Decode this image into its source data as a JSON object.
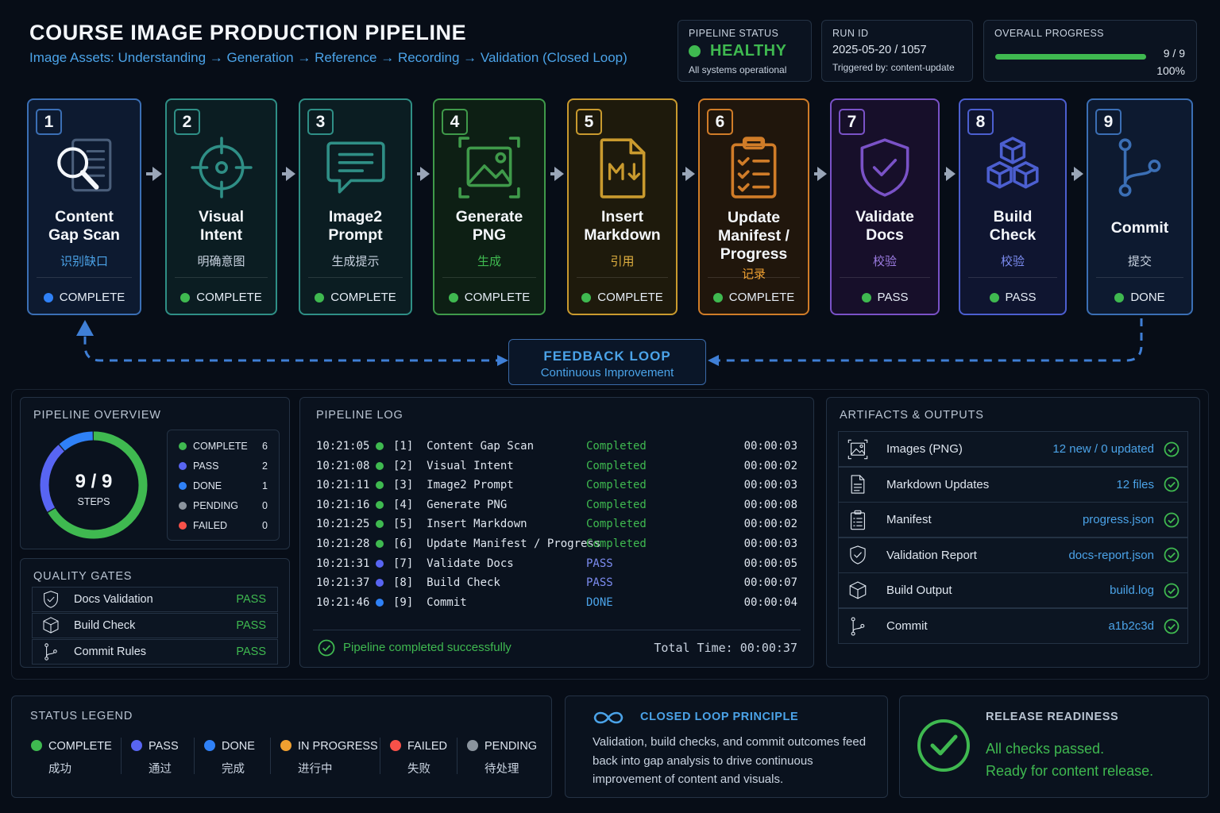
{
  "header": {
    "title": "COURSE IMAGE PRODUCTION PIPELINE",
    "subtitle": "Image Assets: Understanding → Generation → Reference → Recording → Validation (Closed Loop)"
  },
  "pipeline_status": {
    "label": "PIPELINE STATUS",
    "value": "HEALTHY",
    "sub": "All systems operational",
    "color": "#3fb950"
  },
  "run": {
    "label": "RUN ID",
    "value": "2025-05-20 / 1057",
    "sub": "Triggered by: content-update"
  },
  "overall_progress": {
    "label": "OVERALL PROGRESS",
    "count": "9 / 9",
    "percent_text": "100%",
    "fraction": 1.0
  },
  "steps": [
    {
      "num": "1",
      "title": "Content\nGap Scan",
      "cn": "识别缺口",
      "status": "COMPLETE",
      "status_color": "#2f81f7",
      "icon": "magnifier-document-icon",
      "color": "#3b6fb5",
      "bg": "#0d1a30"
    },
    {
      "num": "2",
      "title": "Visual\nIntent",
      "cn": "明确意图",
      "status": "COMPLETE",
      "status_color": "#3fb950",
      "icon": "crosshair-icon",
      "color": "#2f8f86",
      "bg": "#0b1d22"
    },
    {
      "num": "3",
      "title": "Image2\nPrompt",
      "cn": "生成提示",
      "status": "COMPLETE",
      "status_color": "#3fb950",
      "icon": "chat-bubble-icon",
      "color": "#2f8f86",
      "bg": "#0b1d22"
    },
    {
      "num": "4",
      "title": "Generate\nPNG",
      "cn": "生成",
      "status": "COMPLETE",
      "status_color": "#3fb950",
      "icon": "image-icon",
      "color": "#3f9a4a",
      "bg": "#0d1f14"
    },
    {
      "num": "5",
      "title": "Insert\nMarkdown",
      "cn": "引用",
      "status": "COMPLETE",
      "status_color": "#3fb950",
      "icon": "markdown-file-icon",
      "color": "#c99a2e",
      "bg": "#1e1a0c"
    },
    {
      "num": "6",
      "title": "Update\nManifest /\nProgress",
      "cn": "记录",
      "status": "COMPLETE",
      "status_color": "#3fb950",
      "icon": "clipboard-checklist-icon",
      "color": "#d07c28",
      "bg": "#20160c"
    },
    {
      "num": "7",
      "title": "Validate\nDocs",
      "cn": "校验",
      "status": "PASS",
      "status_color": "#3fb950",
      "icon": "shield-check-icon",
      "color": "#7a52c7",
      "bg": "#170f2a"
    },
    {
      "num": "8",
      "title": "Build\nCheck",
      "cn": "校验",
      "status": "PASS",
      "status_color": "#3fb950",
      "icon": "cubes-icon",
      "color": "#4c5fd0",
      "bg": "#0f1530"
    },
    {
      "num": "9",
      "title": "Commit",
      "cn": "提交",
      "status": "DONE",
      "status_color": "#3fb950",
      "icon": "git-branch-icon",
      "color": "#3b6fb5",
      "bg": "#0d1a30"
    }
  ],
  "feedback": {
    "title": "FEEDBACK LOOP",
    "subtitle": "Continuous Improvement"
  },
  "overview": {
    "title": "PIPELINE OVERVIEW",
    "donut_value": "9 / 9",
    "donut_label": "STEPS",
    "counts": [
      {
        "label": "COMPLETE",
        "value": 6,
        "color": "#3fb950"
      },
      {
        "label": "PASS",
        "value": 2,
        "color": "#5865f2"
      },
      {
        "label": "DONE",
        "value": 1,
        "color": "#2f81f7"
      },
      {
        "label": "PENDING",
        "value": 0,
        "color": "#8b949e"
      },
      {
        "label": "FAILED",
        "value": 0,
        "color": "#f85149"
      }
    ]
  },
  "quality_gates": {
    "title": "QUALITY GATES",
    "items": [
      {
        "label": "Docs Validation",
        "value": "PASS",
        "icon": "shield-check-icon"
      },
      {
        "label": "Build Check",
        "value": "PASS",
        "icon": "cube-icon"
      },
      {
        "label": "Commit Rules",
        "value": "PASS",
        "icon": "git-branch-icon"
      }
    ]
  },
  "log": {
    "title": "PIPELINE LOG",
    "rows": [
      {
        "time": "10:21:05",
        "step": "[1]  Content Gap Scan",
        "status": "Completed",
        "duration": "00:00:03",
        "color": "#3fb950"
      },
      {
        "time": "10:21:08",
        "step": "[2]  Visual Intent",
        "status": "Completed",
        "duration": "00:00:02",
        "color": "#3fb950"
      },
      {
        "time": "10:21:11",
        "step": "[3]  Image2 Prompt",
        "status": "Completed",
        "duration": "00:00:03",
        "color": "#3fb950"
      },
      {
        "time": "10:21:16",
        "step": "[4]  Generate PNG",
        "status": "Completed",
        "duration": "00:00:08",
        "color": "#3fb950"
      },
      {
        "time": "10:21:25",
        "step": "[5]  Insert Markdown",
        "status": "Completed",
        "duration": "00:00:02",
        "color": "#3fb950"
      },
      {
        "time": "10:21:28",
        "step": "[6]  Update Manifest / Progress",
        "status": "Completed",
        "duration": "00:00:03",
        "color": "#3fb950"
      },
      {
        "time": "10:21:31",
        "step": "[7]  Validate Docs",
        "status": "PASS",
        "duration": "00:00:05",
        "color": "#5865f2"
      },
      {
        "time": "10:21:37",
        "step": "[8]  Build Check",
        "status": "PASS",
        "duration": "00:00:07",
        "color": "#5865f2"
      },
      {
        "time": "10:21:46",
        "step": "[9]  Commit",
        "status": "DONE",
        "duration": "00:00:04",
        "color": "#2f81f7"
      }
    ],
    "footer": "Pipeline completed successfully",
    "total": "Total Time: 00:00:37"
  },
  "artifacts": {
    "title": "ARTIFACTS & OUTPUTS",
    "items": [
      {
        "label": "Images (PNG)",
        "value": "12 new / 0 updated",
        "icon": "image-icon"
      },
      {
        "label": "Markdown Updates",
        "value": "12 files",
        "icon": "document-icon"
      },
      {
        "label": "Manifest",
        "value": "progress.json",
        "icon": "clipboard-icon"
      },
      {
        "label": "Validation Report",
        "value": "docs-report.json",
        "icon": "shield-check-icon"
      },
      {
        "label": "Build Output",
        "value": "build.log",
        "icon": "cube-icon"
      },
      {
        "label": "Commit",
        "value": "a1b2c3d",
        "icon": "git-branch-icon"
      }
    ]
  },
  "legend": {
    "title": "STATUS LEGEND",
    "items": [
      {
        "label": "COMPLETE",
        "cn": "成功",
        "color": "#3fb950"
      },
      {
        "label": "PASS",
        "cn": "通过",
        "color": "#5865f2"
      },
      {
        "label": "DONE",
        "cn": "完成",
        "color": "#2f81f7"
      },
      {
        "label": "IN PROGRESS",
        "cn": "进行中",
        "color": "#f0a030"
      },
      {
        "label": "FAILED",
        "cn": "失败",
        "color": "#f85149"
      },
      {
        "label": "PENDING",
        "cn": "待处理",
        "color": "#8b949e"
      }
    ]
  },
  "principle": {
    "title": "CLOSED LOOP PRINCIPLE",
    "text": "Validation, build checks, and commit outcomes feed back into gap analysis to drive continuous improvement of content and visuals.",
    "icon": "infinity-icon"
  },
  "release": {
    "title": "RELEASE READINESS",
    "line1": "All checks passed.",
    "line2": "Ready for content release.",
    "icon": "check-circle-icon"
  }
}
